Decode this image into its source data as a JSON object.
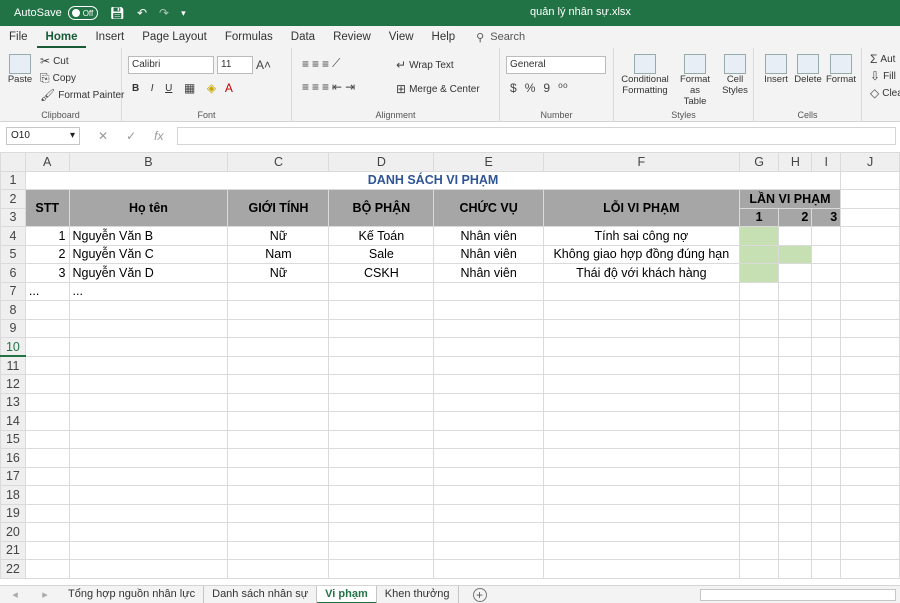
{
  "titlebar": {
    "autosave_label": "AutoSave",
    "autosave_state": "Off",
    "filename": "quản lý nhân sự.xlsx"
  },
  "menu": {
    "items": [
      "File",
      "Home",
      "Insert",
      "Page Layout",
      "Formulas",
      "Data",
      "Review",
      "View",
      "Help"
    ],
    "active": "Home",
    "search_label": "Search"
  },
  "ribbon": {
    "clipboard": {
      "paste": "Paste",
      "cut": "Cut",
      "copy": "Copy",
      "format_painter": "Format Painter",
      "label": "Clipboard"
    },
    "font": {
      "name": "Calibri",
      "size": "11",
      "bold": "B",
      "italic": "I",
      "underline": "U",
      "label": "Font"
    },
    "alignment": {
      "wrap_text": "Wrap Text",
      "merge_center": "Merge & Center",
      "label": "Alignment"
    },
    "number": {
      "format": "General",
      "currency": "$",
      "percent": "%",
      "comma": "9",
      "label": "Number"
    },
    "styles": {
      "conditional": "Conditional",
      "conditional2": "Formatting",
      "format_as": "Format as",
      "format_as2": "Table",
      "cell": "Cell",
      "cell2": "Styles",
      "label": "Styles"
    },
    "cells": {
      "insert": "Insert",
      "delete": "Delete",
      "format": "Format",
      "label": "Cells"
    },
    "editing": {
      "autosum": "Aut",
      "fill": "Fill",
      "clear": "Clea"
    }
  },
  "formula": {
    "name_box": "O10",
    "value": ""
  },
  "columns": [
    "A",
    "B",
    "C",
    "D",
    "E",
    "F",
    "G",
    "H",
    "I",
    "J"
  ],
  "sheet": {
    "title": "DANH SÁCH VI PHẠM",
    "headers": {
      "stt": "STT",
      "name": "Họ tên",
      "gender": "GIỚI TÍNH",
      "dept": "BỘ PHẬN",
      "position": "CHỨC VỤ",
      "violation": "LỖI VI PHẠM",
      "times": "LẦN VI PHẠM",
      "t1": "1",
      "t2": "2",
      "t3": "3"
    },
    "rows": [
      {
        "stt": "1",
        "name": "Nguyễn Văn B",
        "gender": "Nữ",
        "dept": "Kế Toán",
        "position": "Nhân viên",
        "violation": "Tính sai công nợ"
      },
      {
        "stt": "2",
        "name": "Nguyễn Văn C",
        "gender": "Nam",
        "dept": "Sale",
        "position": "Nhân viên",
        "violation": "Không giao hợp đồng đúng hạn"
      },
      {
        "stt": "3",
        "name": "Nguyễn Văn D",
        "gender": "Nữ",
        "dept": "CSKH",
        "position": "Nhân viên",
        "violation": "Thái độ với khách hàng"
      }
    ],
    "ellipsis": "..."
  },
  "tabs": {
    "items": [
      "Tổng hợp nguồn nhân lực",
      "Danh sách nhân sự",
      "Vi phạm",
      "Khen thưởng"
    ],
    "active": "Vi phạm"
  }
}
